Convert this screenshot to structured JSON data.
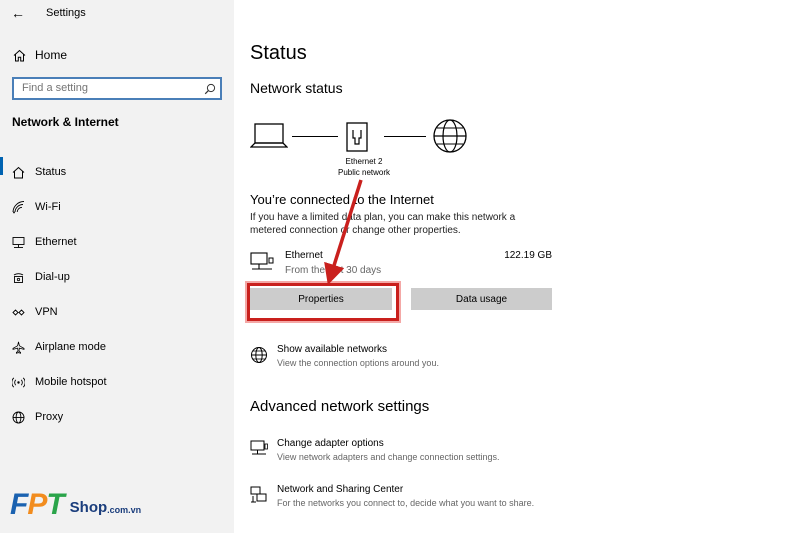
{
  "window": {
    "title": "Settings"
  },
  "sidebar": {
    "home_label": "Home",
    "search_placeholder": "Find a setting",
    "section_heading": "Network & Internet",
    "items": [
      {
        "label": "Status",
        "icon": "home-icon",
        "selected": true
      },
      {
        "label": "Wi-Fi",
        "icon": "wifi-icon"
      },
      {
        "label": "Ethernet",
        "icon": "ethernet-icon"
      },
      {
        "label": "Dial-up",
        "icon": "dialup-icon"
      },
      {
        "label": "VPN",
        "icon": "vpn-icon"
      },
      {
        "label": "Airplane mode",
        "icon": "airplane-icon"
      },
      {
        "label": "Mobile hotspot",
        "icon": "hotspot-icon"
      },
      {
        "label": "Proxy",
        "icon": "globe-icon"
      }
    ]
  },
  "main": {
    "title": "Status",
    "network_status_heading": "Network status",
    "diagram": {
      "network_name": "Ethernet 2",
      "network_type": "Public network"
    },
    "connected_heading": "You’re connected to the Internet",
    "description_line1": "If you have a limited data plan, you can make this network a",
    "description_line2": "metered connection or change other properties.",
    "ethernet": {
      "name": "Ethernet",
      "period": "From the last 30 days",
      "usage": "122.19 GB"
    },
    "buttons": {
      "properties": "Properties",
      "data_usage": "Data usage"
    },
    "show_networks": {
      "title": "Show available networks",
      "subtitle": "View the connection options around you."
    },
    "advanced_heading": "Advanced network settings",
    "adapter_options": {
      "title": "Change adapter options",
      "subtitle": "View network adapters and change connection settings."
    },
    "sharing_center": {
      "title": "Network and Sharing Center",
      "subtitle": "For the networks you connect to, decide what you want to share."
    }
  },
  "logo": {
    "brand": "FPT",
    "shop": "Shop",
    "domain": ".com.vn"
  },
  "colors": {
    "accent": "#0063b1",
    "highlight": "#c9201d",
    "sidebar_bg": "#f2f2f2",
    "button_bg": "#cccccc"
  }
}
